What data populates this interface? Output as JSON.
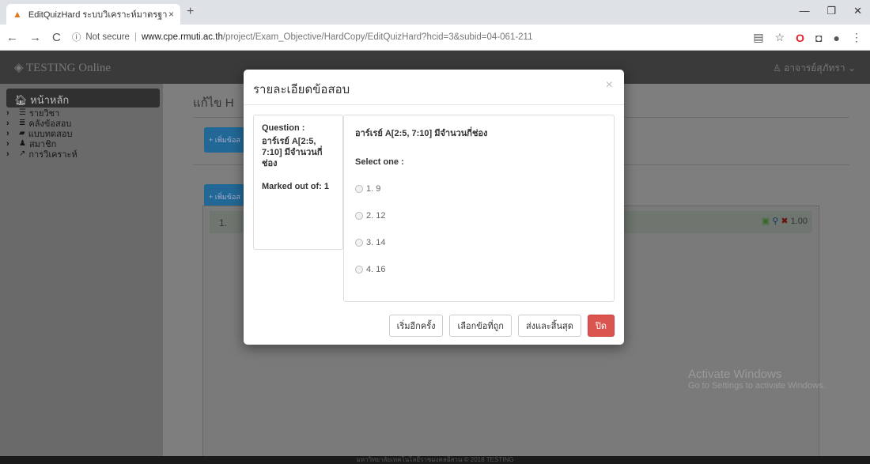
{
  "browser": {
    "tab_title": "EditQuizHard ระบบวิเคราะห์มาตรฐา",
    "tab_close": "×",
    "new_tab": "+",
    "url_info": "ⓘ",
    "url_security": "Not secure",
    "url_sep": "|",
    "url_host": "www.cpe.rmuti.ac.th",
    "url_path": "/project/Exam_Objective/HardCopy/EditQuizHard?hcid=3&subid=04-061-211"
  },
  "app": {
    "brand": "TESTING Online",
    "user": "อาจารย์สุภัทรา",
    "page_title": "แก้ไข H",
    "add_button_1": "+ เพิ่มข้อส",
    "add_button_2": "+ เพิ่มข้อส",
    "row_number": "1.",
    "row_score": "1.00",
    "footer": "มหาวิทยาลัยเทคโนโลยีราชมงคลอีสาน © 2018 TESTING",
    "watermark_title": "Activate Windows",
    "watermark_sub": "Go to Settings to activate Windows."
  },
  "sidebar": {
    "home": "หน้าหลัก",
    "items": [
      {
        "label": "รายวิชา"
      },
      {
        "label": "คลังข้อสอบ"
      },
      {
        "label": "แบบทดสอบ"
      },
      {
        "label": "สมาชิก"
      },
      {
        "label": "การวิเคราะห์"
      }
    ]
  },
  "modal": {
    "title": "รายละเอียดข้อสอบ",
    "close": "×",
    "question_label": "Question :",
    "question_text": "อาร์เรย์ A[2:5, 7:10] มีจำนวนกี่ช่อง",
    "marked_out_of": "Marked out of: 1",
    "select_one": "Select one :",
    "options": [
      "1. 9",
      "2. 12",
      "3. 14",
      "4. 16"
    ],
    "buttons": {
      "restart": "เริ่มอีกครั้ง",
      "select_correct": "เลือกข้อที่ถูก",
      "submit": "ส่งและสิ้นสุด",
      "close": "ปิด"
    }
  }
}
